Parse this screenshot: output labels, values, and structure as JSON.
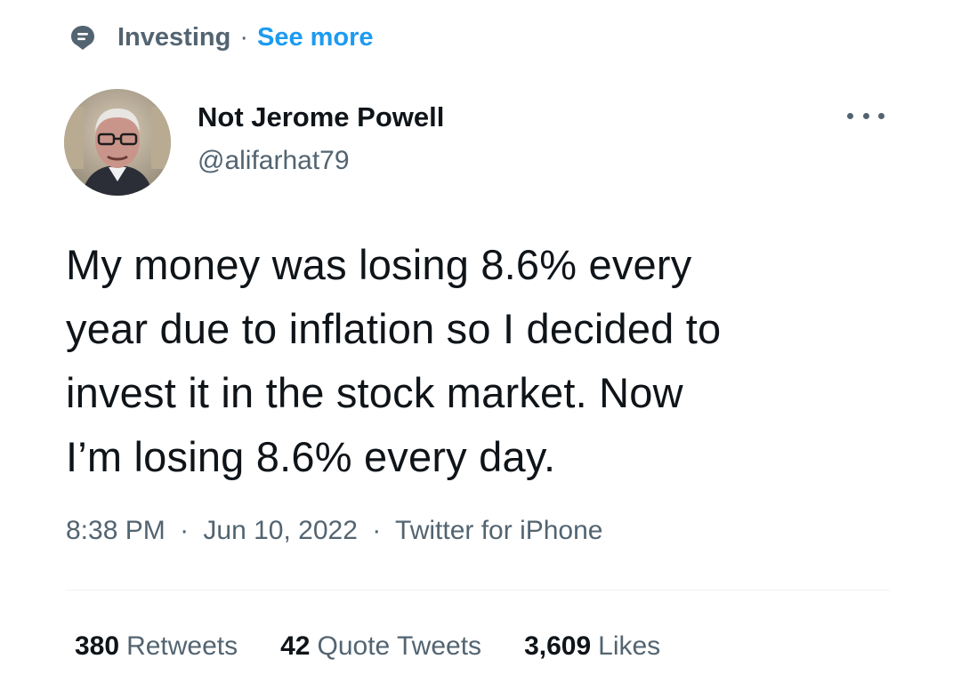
{
  "topic": {
    "icon": "topic-icon",
    "label": "Investing",
    "separator": "·",
    "see_more": "See more"
  },
  "user": {
    "display_name": "Not Jerome Powell",
    "handle": "@alifarhat79",
    "avatar": "avatar"
  },
  "more_icon": "more-horizontal-icon",
  "tweet": {
    "lines": [
      "My money was losing 8.6% every",
      "year due to inflation so I decided to",
      "invest it in the stock market. Now",
      "I’m losing 8.6% every day."
    ]
  },
  "meta": {
    "time": "8:38 PM",
    "separator": "·",
    "date": "Jun 10, 2022",
    "source": "Twitter for iPhone"
  },
  "stats": {
    "retweets_count": "380",
    "retweets_label": "Retweets",
    "quotes_count": "42",
    "quotes_label": "Quote Tweets",
    "likes_count": "3,609",
    "likes_label": "Likes"
  },
  "colors": {
    "text": "#0f1419",
    "secondary": "#536471",
    "accent": "#1d9bf0"
  }
}
